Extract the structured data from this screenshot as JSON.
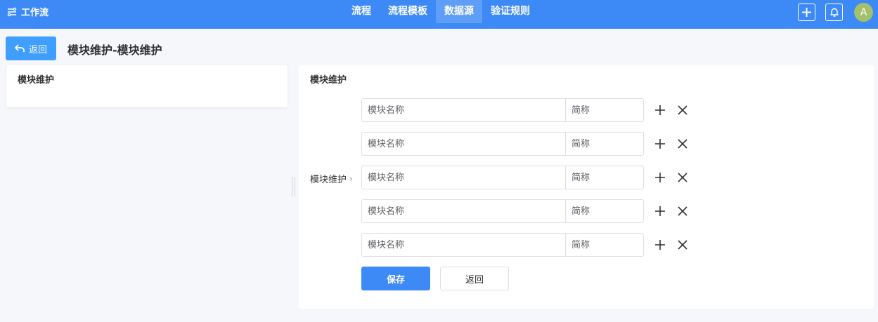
{
  "app": {
    "brand": "工作流",
    "brand_icon": "workflow-icon",
    "accent_color": "#3d8af7"
  },
  "nav": {
    "items": [
      {
        "label": "流程"
      },
      {
        "label": "流程模板"
      },
      {
        "label": "数据源"
      },
      {
        "label": "验证规则"
      }
    ],
    "active": "数据源"
  },
  "topbar": {
    "add_icon": "plus-icon",
    "bell_icon": "bell-icon",
    "avatar": "A"
  },
  "header": {
    "back_label": "返回",
    "back_icon": "return-arrow-icon",
    "title": "模块维护-模块维护"
  },
  "left_panel": {
    "title": "模块维护"
  },
  "right_panel": {
    "title": "模块维护",
    "crumb": "模块维护",
    "crumb_icon": "chevron-right-icon",
    "rows": [
      {
        "name_placeholder": "模块名称",
        "abbr_placeholder": "简称"
      },
      {
        "name_placeholder": "模块名称",
        "abbr_placeholder": "简称"
      },
      {
        "name_placeholder": "模块名称",
        "abbr_placeholder": "简称"
      },
      {
        "name_placeholder": "模块名称",
        "abbr_placeholder": "简称"
      },
      {
        "name_placeholder": "模块名称",
        "abbr_placeholder": "简称"
      }
    ],
    "row_icons": [
      "plus-icon",
      "close-icon"
    ],
    "save_label": "保存",
    "return_label": "返回"
  }
}
